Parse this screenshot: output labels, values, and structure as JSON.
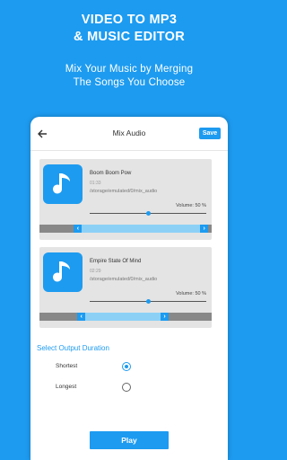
{
  "promo": {
    "title_line1": "VIDEO TO MP3",
    "title_line2": "& MUSIC EDITOR",
    "subtitle_line1": "Mix Your Music by Merging",
    "subtitle_line2": "The Songs You Choose"
  },
  "appbar": {
    "title": "Mix Audio",
    "save_label": "Save",
    "back_icon": "arrow-left-icon"
  },
  "tracks": [
    {
      "name": "Boom Boom Pow",
      "time": "01:33",
      "path": "/storage/emulated/0/mix_audio",
      "volume_label": "Volume: 50 %",
      "volume": 0.5,
      "range_start": 0.2,
      "range_end": 0.98
    },
    {
      "name": "Empire State Of Mind",
      "time": "02:29",
      "path": "/storage/emulated/0/mix_audio",
      "volume_label": "Volume: 50 %",
      "volume": 0.5,
      "range_start": 0.22,
      "range_end": 0.75
    }
  ],
  "duration": {
    "title": "Select Output Duration",
    "options": [
      {
        "label": "Shortest",
        "selected": true
      },
      {
        "label": "Longest",
        "selected": false
      }
    ]
  },
  "play_label": "Play",
  "colors": {
    "accent": "#1d9bf0",
    "range_selected": "#8cd0f6",
    "card": "#e4e4e4"
  }
}
